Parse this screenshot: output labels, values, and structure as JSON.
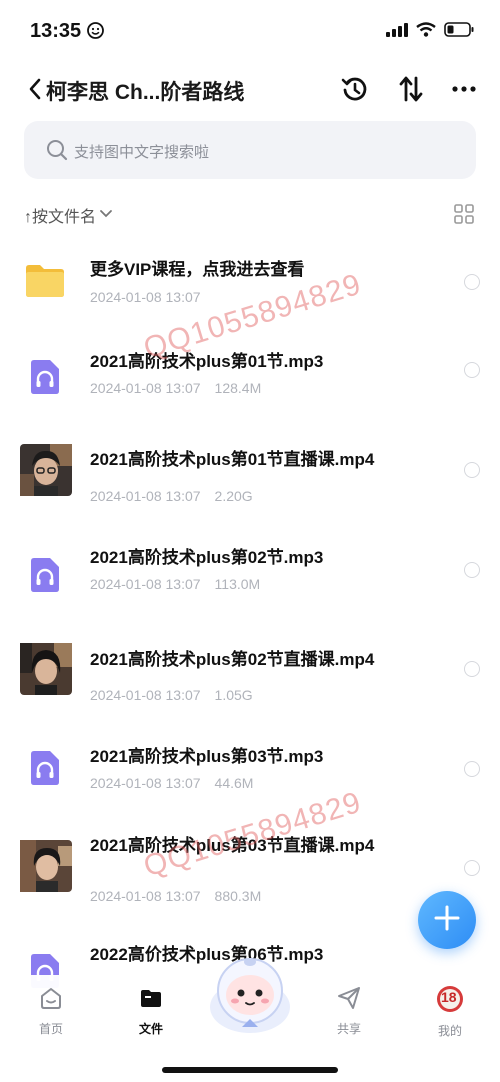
{
  "status": {
    "time": "13:35"
  },
  "header": {
    "title": "柯李思 Ch...阶者路线",
    "icons": [
      "back-icon",
      "history-icon",
      "sort-arrows-icon",
      "more-icon"
    ]
  },
  "search": {
    "placeholder": "支持图中文字搜索啦"
  },
  "sort": {
    "label": "↑按文件名"
  },
  "files": [
    {
      "name": "更多VIP课程，点我进去查看",
      "date": "2024-01-08 13:07",
      "size": "",
      "type": "folder"
    },
    {
      "name": "2021高阶技术plus第01节.mp3",
      "date": "2024-01-08 13:07",
      "size": "128.4M",
      "type": "audio"
    },
    {
      "name": "2021高阶技术plus第01节直播课.mp4",
      "date": "2024-01-08 13:07",
      "size": "2.20G",
      "type": "video"
    },
    {
      "name": "2021高阶技术plus第02节.mp3",
      "date": "2024-01-08 13:07",
      "size": "113.0M",
      "type": "audio"
    },
    {
      "name": "2021高阶技术plus第02节直播课.mp4",
      "date": "2024-01-08 13:07",
      "size": "1.05G",
      "type": "video"
    },
    {
      "name": "2021高阶技术plus第03节.mp3",
      "date": "2024-01-08 13:07",
      "size": "44.6M",
      "type": "audio"
    },
    {
      "name": "2021高阶技术plus第03节直播课.mp4",
      "date": "2024-01-08 13:07",
      "size": "880.3M",
      "type": "video"
    },
    {
      "name": "2022高价技术plus第06节.mp3",
      "date": "",
      "size": "",
      "type": "audio"
    }
  ],
  "watermarks": [
    "QQ1055894829",
    "QQ1055894829"
  ],
  "tabbar": {
    "tabs": [
      {
        "label": "首页",
        "icon": "home-icon"
      },
      {
        "label": "文件",
        "icon": "folder-icon",
        "active": true
      },
      {
        "label": "共享",
        "icon": "share-icon"
      },
      {
        "label": "我的",
        "icon": "avatar-icon"
      }
    ],
    "avatar_badge": "18"
  },
  "colors": {
    "accent": "#2e8df5",
    "audio_icon": "#8a7cf0",
    "folder": "#f7c948",
    "watermark": "#e15a5a"
  }
}
